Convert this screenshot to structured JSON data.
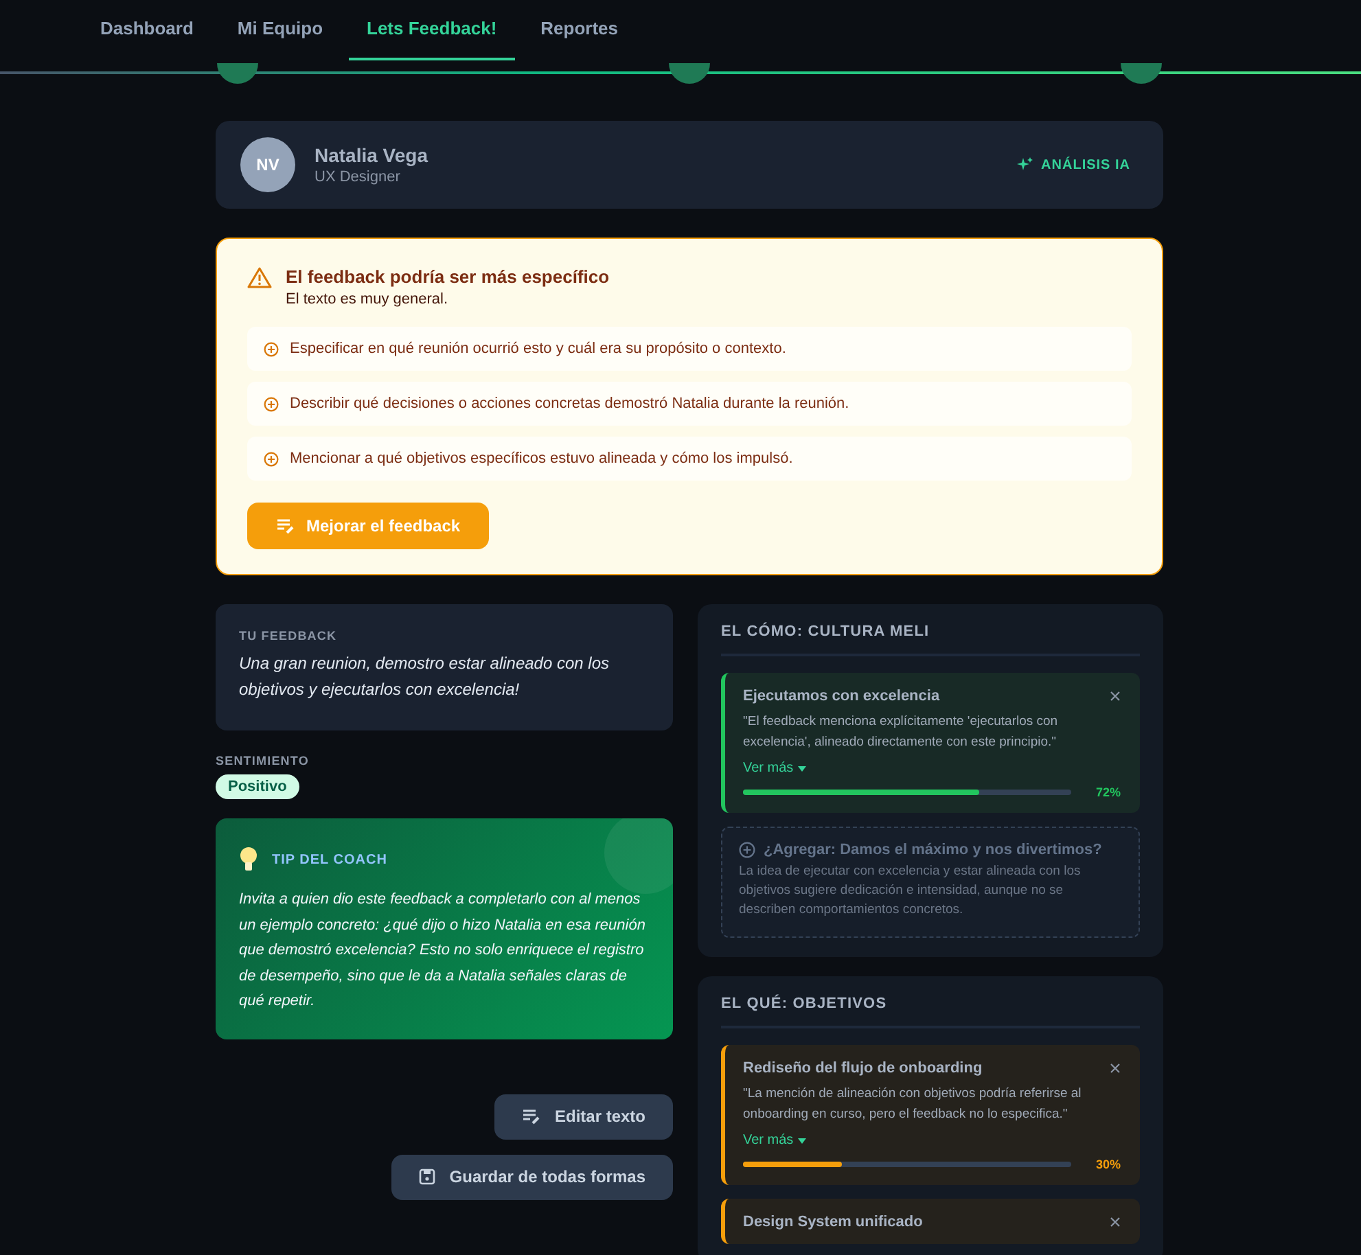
{
  "nav": {
    "tabs": [
      {
        "label": "Dashboard",
        "selected": false
      },
      {
        "label": "Mi Equipo",
        "selected": false
      },
      {
        "label": "Lets Feedback!",
        "selected": true
      },
      {
        "label": "Reportes",
        "selected": false
      }
    ]
  },
  "person": {
    "initials": "NV",
    "name": "Natalia Vega",
    "role": "UX Designer",
    "action": "ANÁLISIS IA"
  },
  "warning": {
    "title": "El feedback podría ser más específico",
    "subtitle": "El texto es muy general.",
    "suggestions": [
      "Especificar en qué reunión ocurrió esto y cuál era su propósito o contexto.",
      "Describir qué decisiones o acciones concretas demostró Natalia durante la reunión.",
      "Mencionar a qué objetivos específicos estuvo alineada y cómo los impulsó."
    ],
    "button": "Mejorar el feedback"
  },
  "feedback": {
    "label": "TU FEEDBACK",
    "text": "Una gran reunion, demostro estar alineado con los objetivos y ejecutarlos con excelencia!"
  },
  "sentiment": {
    "label": "SENTIMIENTO",
    "value": "Positivo"
  },
  "tip": {
    "title": "TIP DEL COACH",
    "text": "Invita a quien dio este feedback a completarlo con al menos un ejemplo concreto: ¿qué dijo o hizo Natalia en esa reunión que demostró excelencia? Esto no solo enriquece el registro de desempeño, sino que le da a Natalia señales claras de qué repetir."
  },
  "actions": [
    "Editar texto",
    "Guardar de todas formas"
  ],
  "sections": [
    {
      "title": "EL CÓMO: CULTURA MELI",
      "items": [
        {
          "kind": "match",
          "title": "Ejecutamos con excelencia",
          "quote": "\"El feedback menciona explícitamente 'ejecutarlos con excelencia', alineado directamente con este principio.\"",
          "more": "Ver más",
          "level": 0.72,
          "percent": "72%",
          "color": "#22c55e"
        },
        {
          "kind": "suggestion",
          "title": "¿Agregar: Damos el máximo y nos divertimos?",
          "text": "La idea de ejecutar con excelencia y estar alineada con los objetivos sugiere dedicación e intensidad, aunque no se describen comportamientos concretos."
        }
      ]
    },
    {
      "title": "EL QUÉ: OBJETIVOS",
      "items": [
        {
          "kind": "match",
          "title": "Rediseño del flujo de onboarding",
          "quote": "\"La mención de alineación con objetivos podría referirse al onboarding en curso, pero el feedback no lo especifica.\"",
          "more": "Ver más",
          "level": 0.3,
          "percent": "30%",
          "color": "#f59e0b"
        },
        {
          "kind": "match",
          "title": "Design System unificado",
          "color": "#f59e0b"
        }
      ]
    }
  ]
}
